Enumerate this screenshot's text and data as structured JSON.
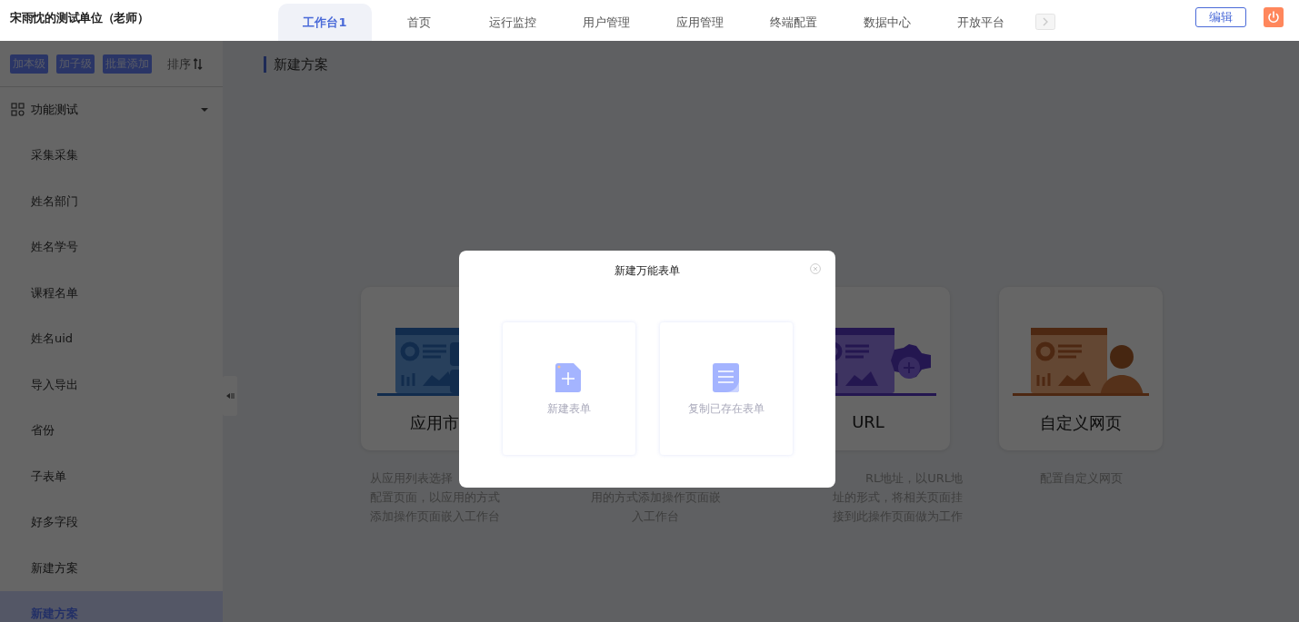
{
  "header": {
    "title": "宋雨忱的测试单位（老师）",
    "nav_tabs": [
      {
        "label": "工作台1",
        "selected": true
      },
      {
        "label": "首页",
        "selected": false
      },
      {
        "label": "运行监控",
        "selected": false
      },
      {
        "label": "用户管理",
        "selected": false
      },
      {
        "label": "应用管理",
        "selected": false
      },
      {
        "label": "终端配置",
        "selected": false
      },
      {
        "label": "数据中心",
        "selected": false
      },
      {
        "label": "开放平台",
        "selected": false
      }
    ],
    "edit_button": "编辑"
  },
  "sidebar": {
    "actions": [
      "加本级",
      "加子级",
      "批量添加"
    ],
    "sort_label": "排序",
    "tree": [
      {
        "label": "功能测试",
        "expanded": true,
        "children": [
          {
            "label": "采集采集",
            "selected": false
          },
          {
            "label": "姓名部门",
            "selected": false
          },
          {
            "label": "姓名学号",
            "selected": false
          },
          {
            "label": "课程名单",
            "selected": false
          },
          {
            "label": "姓名uid",
            "selected": false
          },
          {
            "label": "导入导出",
            "selected": false
          },
          {
            "label": "省份",
            "selected": false
          },
          {
            "label": "子表单",
            "selected": false
          },
          {
            "label": "好多字段",
            "selected": false
          },
          {
            "label": "新建方案",
            "selected": false
          },
          {
            "label": "新建方案",
            "selected": true
          }
        ]
      }
    ]
  },
  "main": {
    "heading": "新建方案",
    "cards": [
      {
        "kind": "app",
        "title": "应用市",
        "description": [
          "从应用列表选择",
          "配置页面，以应用的方式",
          "添加操作页面嵌入工作台"
        ]
      },
      {
        "kind": "form",
        "description": [
          "用的方式添加操作页面嵌",
          "入工作台"
        ]
      },
      {
        "kind": "url",
        "title": "URL",
        "description": [
          "RL地址，以URL地",
          "址的形式，将相关页面挂",
          "接到此操作页面做为工作"
        ]
      },
      {
        "kind": "custom",
        "title": "自定义网页",
        "description": [
          "配置自定义网页"
        ]
      }
    ]
  },
  "modal": {
    "title": "新建万能表单",
    "options": [
      {
        "kind": "new",
        "label": "新建表单"
      },
      {
        "kind": "copy",
        "label": "复制已存在表单"
      }
    ]
  }
}
